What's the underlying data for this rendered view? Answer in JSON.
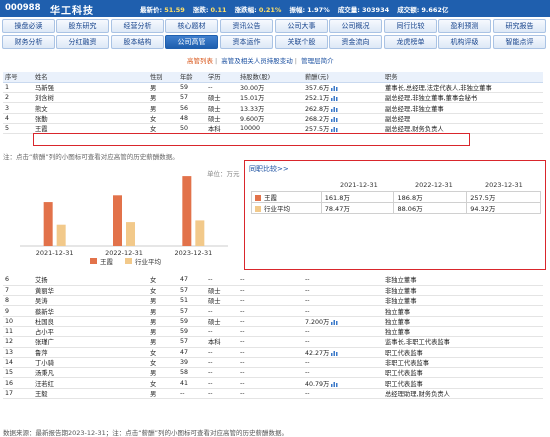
{
  "header": {
    "code": "000988",
    "name": "华工科技",
    "stats": [
      {
        "label": "最新价:",
        "value": "51.59"
      },
      {
        "label": "涨跌:",
        "value": "0.11"
      },
      {
        "label": "涨跌幅:",
        "value": "0.21%"
      },
      {
        "label": "振幅:",
        "value": "1.97%"
      },
      {
        "label": "成交量:",
        "value": "303934"
      },
      {
        "label": "成交额:",
        "value": "9.662亿"
      }
    ]
  },
  "nav": {
    "row1": [
      "操盘必读",
      "股东研究",
      "经营分析",
      "核心题材",
      "资讯公告",
      "公司大事",
      "公司概况",
      "同行比较",
      "盈利预测",
      "研究报告"
    ],
    "row2": [
      "财务分析",
      "分红融资",
      "股本结构",
      "公司高管",
      "资本运作",
      "关联个股",
      "资金流向",
      "龙虎榜单",
      "机构评级",
      "智能点评"
    ],
    "active": "公司高管"
  },
  "subtabs": [
    "高管列表",
    "高管及相关人员持股变动",
    "管理层简介"
  ],
  "table_top": {
    "headers": [
      "序号",
      "姓名",
      "性别",
      "年龄",
      "学历",
      "持股数(股)",
      "薪酬(元)",
      "职务"
    ],
    "rows": [
      [
        "1",
        "马新强",
        "男",
        "59",
        "--",
        "30.00万",
        "357.6万",
        "董事长,总经理,法定代表人,非独立董事"
      ],
      [
        "2",
        "刘含树",
        "男",
        "57",
        "硕士",
        "15.01万",
        "252.1万",
        "副总经理,非独立董事,董事会秘书"
      ],
      [
        "3",
        "熊文",
        "男",
        "56",
        "硕士",
        "13.33万",
        "262.8万",
        "副总经理,非独立董事"
      ],
      [
        "4",
        "张勤",
        "女",
        "48",
        "硕士",
        "9.600万",
        "268.2万",
        "副总经理"
      ],
      [
        "5",
        "王霞",
        "女",
        "50",
        "本科",
        "10000",
        "257.5万",
        "副总经理,财务负责人"
      ]
    ]
  },
  "note1": {
    "text": "注：点击“薪酬”列的小图标可查看对应高管的历史薪酬数据。"
  },
  "chart_data": {
    "type": "bar",
    "unit": "单位：万元",
    "categories": [
      "2021-12-31",
      "2022-12-31",
      "2023-12-31"
    ],
    "series": [
      {
        "name": "王霞",
        "color": "#e2724a",
        "values": [
          161.8,
          186.8,
          257.5
        ]
      },
      {
        "name": "行业平均",
        "color": "#f2c98a",
        "values": [
          78.47,
          88.06,
          94.32
        ]
      }
    ],
    "ylim": [
      0,
      280
    ]
  },
  "compare": {
    "title": "同职比较>>",
    "years": [
      "2021-12-31",
      "2022-12-31",
      "2023-12-31"
    ],
    "rows": [
      {
        "label": "王霞",
        "color": "#e2724a",
        "values": [
          "161.8万",
          "186.8万",
          "257.5万"
        ]
      },
      {
        "label": "行业平均",
        "color": "#f2c98a",
        "values": [
          "78.47万",
          "88.06万",
          "94.32万"
        ]
      }
    ]
  },
  "table_bottom": {
    "rows": [
      [
        "6",
        "艾扬",
        "女",
        "47",
        "--",
        "--",
        "--",
        "非独立董事"
      ],
      [
        "7",
        "黄丽华",
        "女",
        "57",
        "硕士",
        "--",
        "--",
        "非独立董事"
      ],
      [
        "8",
        "吴涛",
        "男",
        "51",
        "硕士",
        "--",
        "--",
        "非独立董事"
      ],
      [
        "9",
        "蔡新华",
        "男",
        "57",
        "--",
        "--",
        "--",
        "独立董事"
      ],
      [
        "10",
        "杜国良",
        "男",
        "59",
        "硕士",
        "--",
        "7.200万",
        "独立董事"
      ],
      [
        "11",
        "占小平",
        "男",
        "59",
        "--",
        "--",
        "--",
        "独立董事"
      ],
      [
        "12",
        "张瑾广",
        "男",
        "57",
        "本科",
        "--",
        "--",
        "监事长,非职工代表监事"
      ],
      [
        "13",
        "鲁萍",
        "女",
        "47",
        "--",
        "--",
        "42.27万",
        "职工代表监事"
      ],
      [
        "14",
        "丁小骑",
        "女",
        "39",
        "--",
        "--",
        "--",
        "非职工代表监事"
      ],
      [
        "15",
        "汤秉凡",
        "男",
        "58",
        "--",
        "--",
        "--",
        "职工代表监事"
      ],
      [
        "16",
        "汪若红",
        "女",
        "41",
        "--",
        "--",
        "40.79万",
        "职工代表监事"
      ],
      [
        "17",
        "王毅",
        "男",
        "--",
        "--",
        "--",
        "--",
        "总经理助理,财务负责人"
      ]
    ]
  },
  "footer": {
    "text": "数据来源：最新报告期2023-12-31；注：点击“薪酬”列的小图标可查看对应高管的历史薪酬数据。"
  }
}
